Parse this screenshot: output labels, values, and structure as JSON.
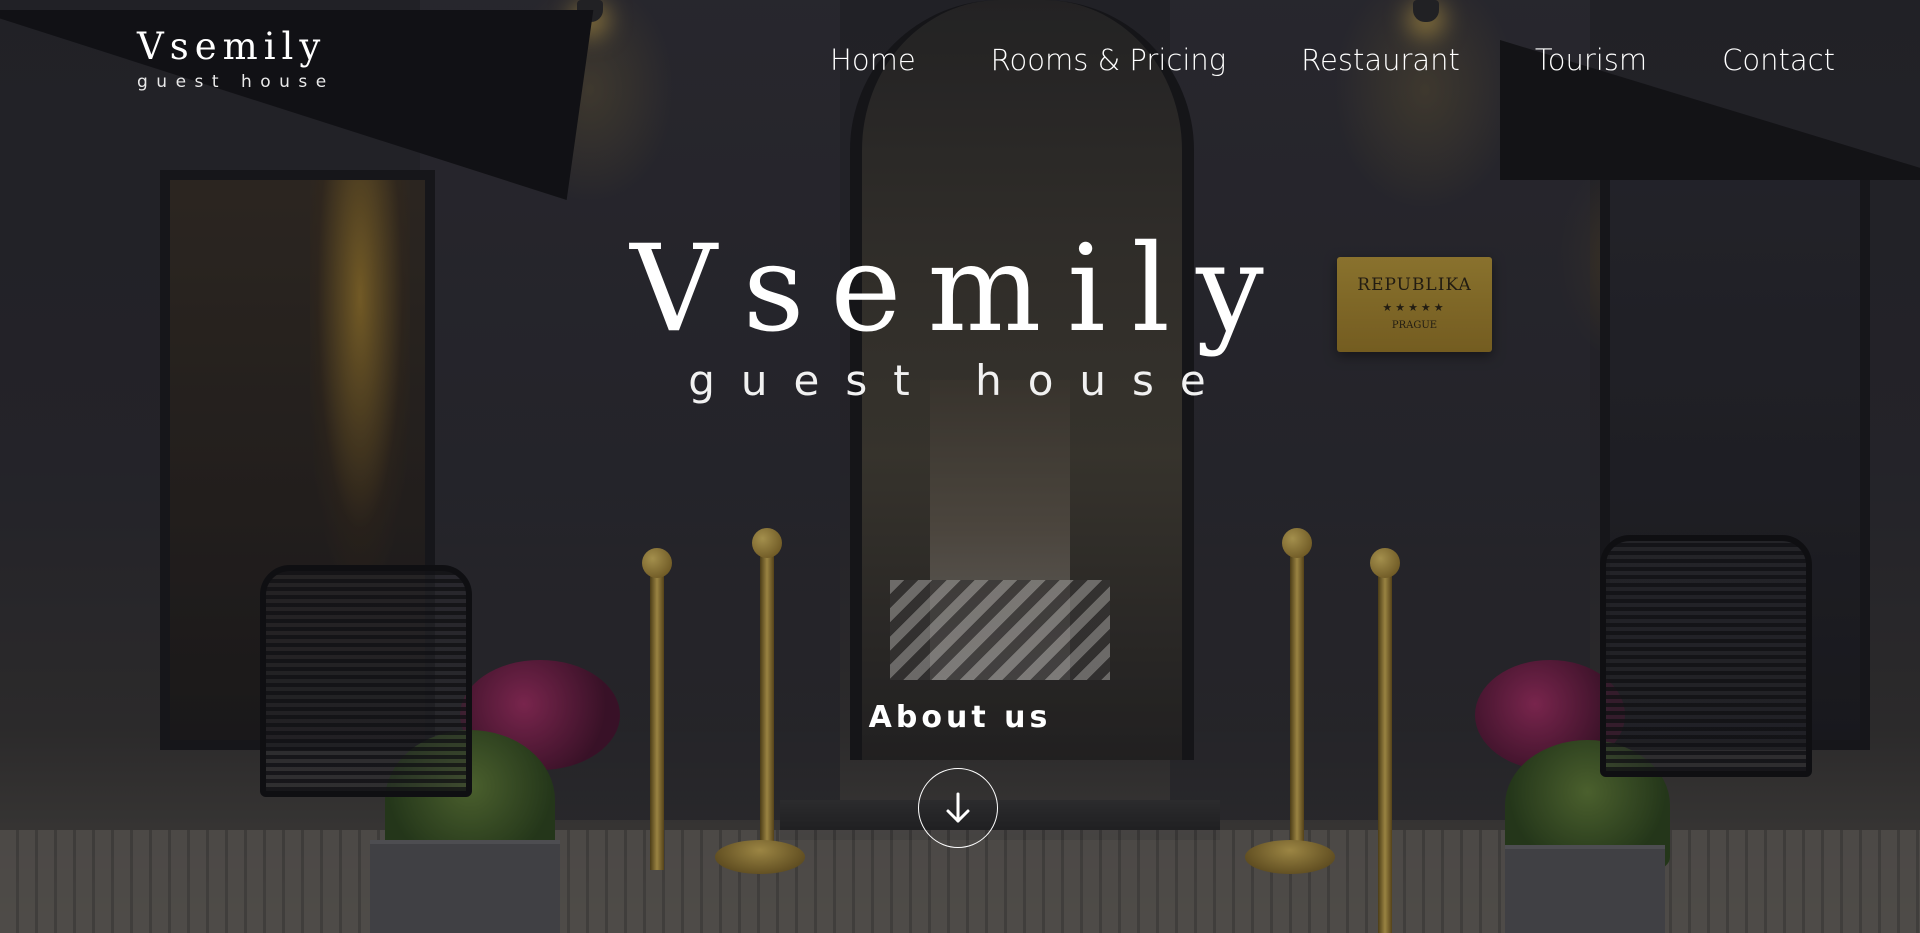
{
  "brand": {
    "name": "Vsemily",
    "tagline": "guest house"
  },
  "nav": {
    "items": [
      {
        "label": "Home"
      },
      {
        "label": "Rooms & Pricing"
      },
      {
        "label": "Restaurant"
      },
      {
        "label": "Tourism"
      },
      {
        "label": "Contact"
      }
    ]
  },
  "hero": {
    "title": "Vsemily",
    "subtitle": "guest house",
    "background_plaque": {
      "name": "REPUBLIKA",
      "stars": "★★★★★",
      "city": "PRAGUE"
    }
  },
  "about": {
    "label": "About us",
    "scroll_icon": "arrow-down-icon"
  },
  "colors": {
    "text": "#ffffff",
    "accent_gold": "#d4ab3c",
    "overlay": "#121218"
  }
}
